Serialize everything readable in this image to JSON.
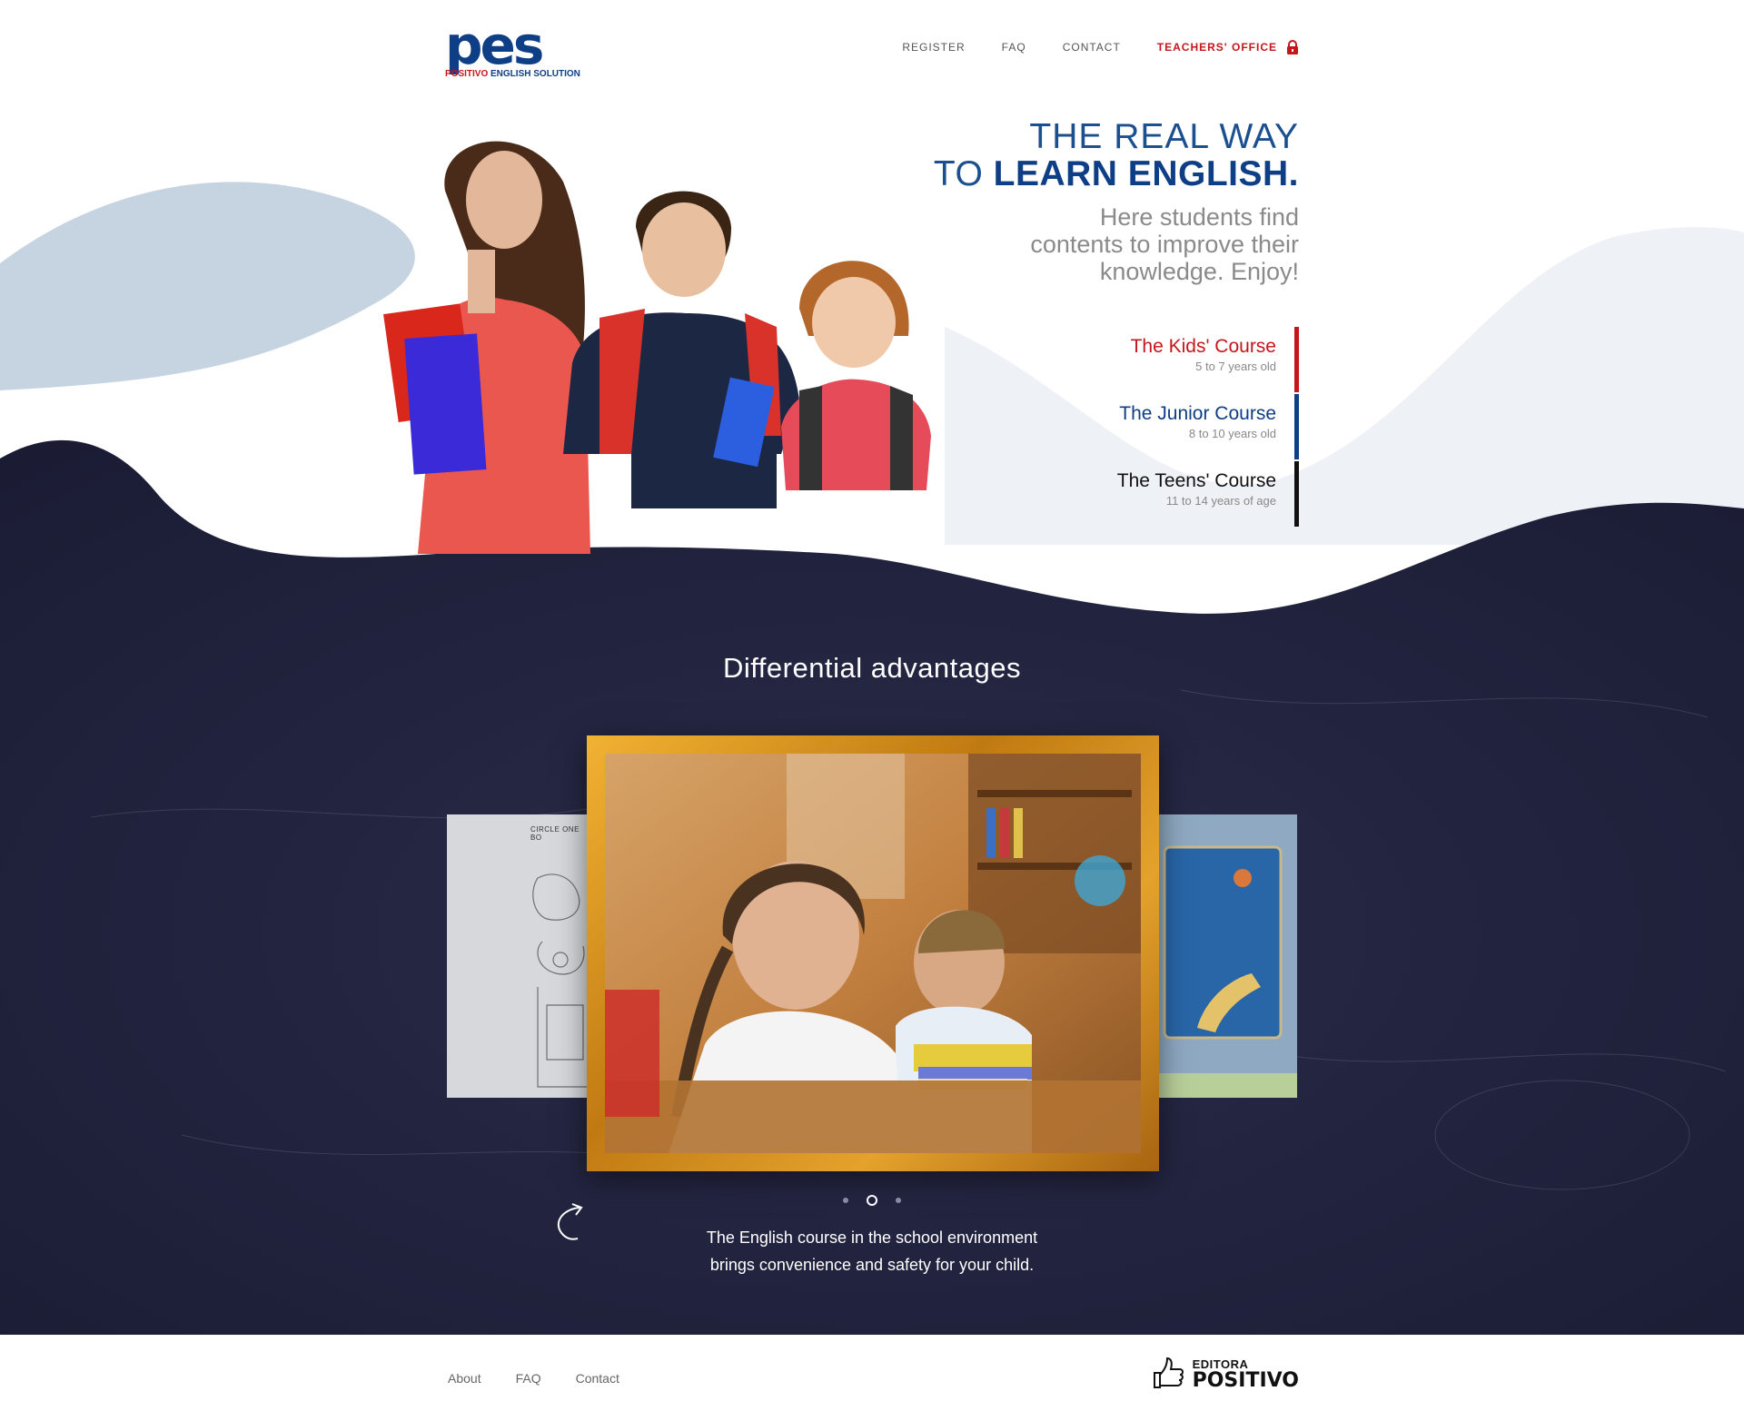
{
  "brand": {
    "logo_mark": "pes",
    "logo_sub_red": "POSITIVO",
    "logo_sub_blue": "ENGLISH SOLUTION"
  },
  "nav": {
    "items": [
      {
        "label": "REGISTER"
      },
      {
        "label": "FAQ"
      },
      {
        "label": "CONTACT"
      }
    ],
    "office_label": "TEACHERS' OFFICE",
    "office_icon": "lock-icon"
  },
  "hero": {
    "line1": "THE REAL WAY",
    "line2_prefix": "TO ",
    "line2_bold": "LEARN ENGLISH.",
    "tagline_1": "Here students find",
    "tagline_2": "contents to improve their",
    "tagline_3": "knowledge. Enjoy!"
  },
  "courses": [
    {
      "title": "The Kids' Course",
      "age": "5 to 7 years old",
      "color": "#c4161c"
    },
    {
      "title": "The Junior Course",
      "age": "8 to 10 years old",
      "color": "#0e3e85"
    },
    {
      "title": "The Teens' Course",
      "age": "11 to 14 years of age",
      "color": "#111111"
    }
  ],
  "advantages": {
    "title": "Differential advantages",
    "worksheet_title": "CIRCLE ONE BO",
    "caption_1": "The English course in the school environment",
    "caption_2": "brings convenience and safety for your child.",
    "slides_total": 3,
    "active_slide": 2
  },
  "footer": {
    "links": [
      {
        "label": "About"
      },
      {
        "label": "FAQ"
      },
      {
        "label": "Contact"
      }
    ],
    "publisher_small": "EDITORA",
    "publisher_big": "POSITIVO"
  },
  "colors": {
    "brand_blue": "#0e3e85",
    "brand_red": "#c4161c",
    "chalkboard": "#24253f",
    "wave_light": "#c6d4e2"
  }
}
